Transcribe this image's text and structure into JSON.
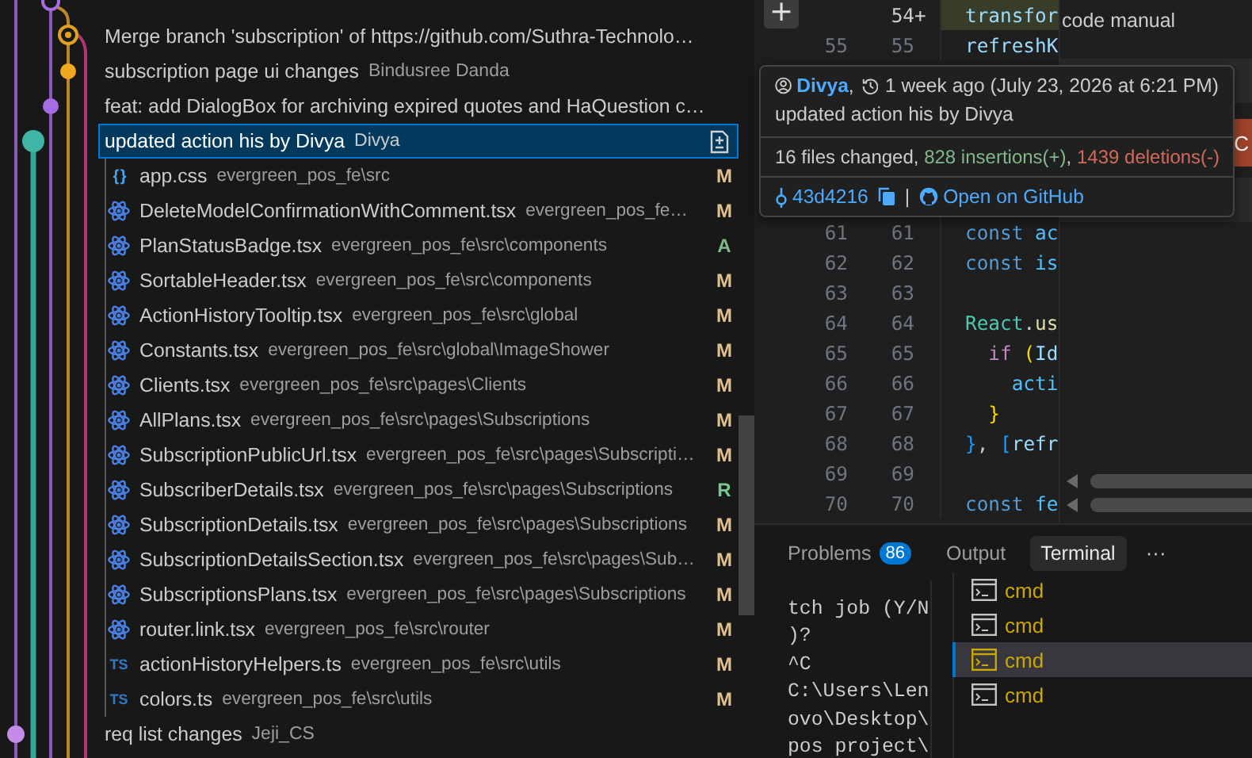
{
  "commits": [
    {
      "message": "Merge branch 'subscription' of https://github.com/Suthra-Technolo…",
      "selected": false
    },
    {
      "message": "subscription page ui changes",
      "author": "Bindusree Danda",
      "selected": false
    },
    {
      "message": "feat: add DialogBox for archiving expired quotes and HaQuestion c…",
      "selected": false
    },
    {
      "message": "updated action his by Divya",
      "author": "Divya",
      "selected": true,
      "files": [
        {
          "kind": "css",
          "icon_label": "{ }",
          "name": "app.css",
          "path": "evergreen_pos_fe\\src",
          "status": "M",
          "color": "#e2c08d"
        },
        {
          "kind": "react",
          "name": "DeleteModelConfirmationWithComment.tsx",
          "path": "evergreen_pos_fe…",
          "status": "M",
          "color": "#e2c08d"
        },
        {
          "kind": "react",
          "name": "PlanStatusBadge.tsx",
          "path": "evergreen_pos_fe\\src\\components",
          "status": "A",
          "color": "#81b88b"
        },
        {
          "kind": "react",
          "name": "SortableHeader.tsx",
          "path": "evergreen_pos_fe\\src\\components",
          "status": "M",
          "color": "#e2c08d"
        },
        {
          "kind": "react",
          "name": "ActionHistoryTooltip.tsx",
          "path": "evergreen_pos_fe\\src\\global",
          "status": "M",
          "color": "#e2c08d"
        },
        {
          "kind": "react",
          "name": "Constants.tsx",
          "path": "evergreen_pos_fe\\src\\global\\ImageShower",
          "status": "M",
          "color": "#e2c08d"
        },
        {
          "kind": "react",
          "name": "Clients.tsx",
          "path": "evergreen_pos_fe\\src\\pages\\Clients",
          "status": "M",
          "color": "#e2c08d"
        },
        {
          "kind": "react",
          "name": "AllPlans.tsx",
          "path": "evergreen_pos_fe\\src\\pages\\Subscriptions",
          "status": "M",
          "color": "#e2c08d"
        },
        {
          "kind": "react",
          "name": "SubscriptionPublicUrl.tsx",
          "path": "evergreen_pos_fe\\src\\pages\\Subscripti…",
          "status": "M",
          "color": "#e2c08d"
        },
        {
          "kind": "react",
          "name": "SubscriberDetails.tsx",
          "path": "evergreen_pos_fe\\src\\pages\\Subscriptions",
          "status": "R",
          "color": "#73c991"
        },
        {
          "kind": "react",
          "name": "SubscriptionDetails.tsx",
          "path": "evergreen_pos_fe\\src\\pages\\Subscriptions",
          "status": "M",
          "color": "#e2c08d"
        },
        {
          "kind": "react",
          "name": "SubscriptionDetailsSection.tsx",
          "path": "evergreen_pos_fe\\src\\pages\\Sub…",
          "status": "M",
          "color": "#e2c08d"
        },
        {
          "kind": "react",
          "name": "SubscriptionsPlans.tsx",
          "path": "evergreen_pos_fe\\src\\pages\\Subscriptions",
          "status": "M",
          "color": "#e2c08d"
        },
        {
          "kind": "react",
          "name": "router.link.tsx",
          "path": "evergreen_pos_fe\\src\\router",
          "status": "M",
          "color": "#e2c08d"
        },
        {
          "kind": "ts",
          "icon_label": "TS",
          "name": "actionHistoryHelpers.ts",
          "path": "evergreen_pos_fe\\src\\utils",
          "status": "M",
          "color": "#e2c08d"
        },
        {
          "kind": "ts",
          "icon_label": "TS",
          "name": "colors.ts",
          "path": "evergreen_pos_fe\\src\\utils",
          "status": "M",
          "color": "#e2c08d"
        }
      ]
    },
    {
      "message": "req list changes",
      "author": "Jeji_CS",
      "selected": false
    }
  ],
  "tooltip": {
    "author": "Divya",
    "author_suffix": ",",
    "time": "1 week ago (July 23, 2026 at 6:21 PM)",
    "message": "updated action his by Divya",
    "stats": {
      "summary": "16 files changed,",
      "insertions": "828 insertions(+)",
      "separator": ",",
      "deletions": "1439 deletions(-)"
    },
    "hash": "43d4216",
    "divider": "|",
    "link": "Open on GitHub"
  },
  "editor": {
    "add_button": "+",
    "hunks": [
      {
        "lines": [
          {
            "kind": "added",
            "new": "54",
            "marker": "+",
            "code": [
              {
                "text": "transfor",
                "kind": "prop"
              }
            ]
          },
          {
            "kind": "context",
            "old": "55",
            "new": "55",
            "code": [
              {
                "text": "refreshK",
                "kind": "prop"
              }
            ]
          }
        ]
      },
      {
        "lines": [
          {
            "kind": "context",
            "old": "61",
            "new": "61",
            "code": [
              {
                "text": "const ",
                "kind": "keyword"
              },
              {
                "text": "ac",
                "kind": "const"
              }
            ]
          },
          {
            "kind": "context",
            "old": "62",
            "new": "62",
            "code": [
              {
                "text": "const ",
                "kind": "keyword"
              },
              {
                "text": "is",
                "kind": "const"
              }
            ]
          },
          {
            "kind": "context",
            "old": "63",
            "new": "63"
          },
          {
            "kind": "context",
            "old": "64",
            "new": "64",
            "code": [
              {
                "text": "React",
                "kind": "type"
              },
              {
                "text": ".",
                "kind": "plain"
              },
              {
                "text": "us",
                "kind": "func"
              }
            ]
          },
          {
            "kind": "context",
            "old": "65",
            "new": "65",
            "code": [
              {
                "text": "  if ",
                "kind": "control"
              },
              {
                "text": "(",
                "kind": "bracket-gold"
              },
              {
                "text": "Id",
                "kind": "prop"
              }
            ]
          },
          {
            "kind": "context",
            "old": "66",
            "new": "66",
            "code": [
              {
                "text": "    acti",
                "kind": "const"
              }
            ]
          },
          {
            "kind": "context",
            "old": "67",
            "new": "67",
            "code": [
              {
                "text": "  }",
                "kind": "bracket-gold"
              }
            ]
          },
          {
            "kind": "context",
            "old": "68",
            "new": "68",
            "code": [
              {
                "text": "}",
                "kind": "bracket-blue"
              },
              {
                "text": ", ",
                "kind": "plain"
              },
              {
                "text": "[",
                "kind": "bracket-blue"
              },
              {
                "text": "refr",
                "kind": "prop"
              }
            ]
          },
          {
            "kind": "context",
            "old": "69",
            "new": "69"
          },
          {
            "kind": "context",
            "old": "70",
            "new": "70",
            "code": [
              {
                "text": "const ",
                "kind": "keyword"
              },
              {
                "text": "fe",
                "kind": "const"
              }
            ]
          }
        ]
      }
    ]
  },
  "side_panel": {
    "text": "code manual",
    "button": "C"
  },
  "panel": {
    "tabs": [
      {
        "label": "Problems",
        "badge": "86",
        "selected": false
      },
      {
        "label": "Output",
        "selected": false
      },
      {
        "label": "Terminal",
        "selected": true
      }
    ],
    "more": "···",
    "terminal_lines": [
      "tch job (Y/N",
      ")?",
      "^C",
      "C:\\Users\\Len",
      "ovo\\Desktop\\",
      "pos project\\"
    ],
    "terminals": [
      {
        "label": "cmd",
        "selected": false
      },
      {
        "label": "cmd",
        "selected": false
      },
      {
        "label": "cmd",
        "selected": true
      },
      {
        "label": "cmd",
        "selected": false
      }
    ]
  }
}
